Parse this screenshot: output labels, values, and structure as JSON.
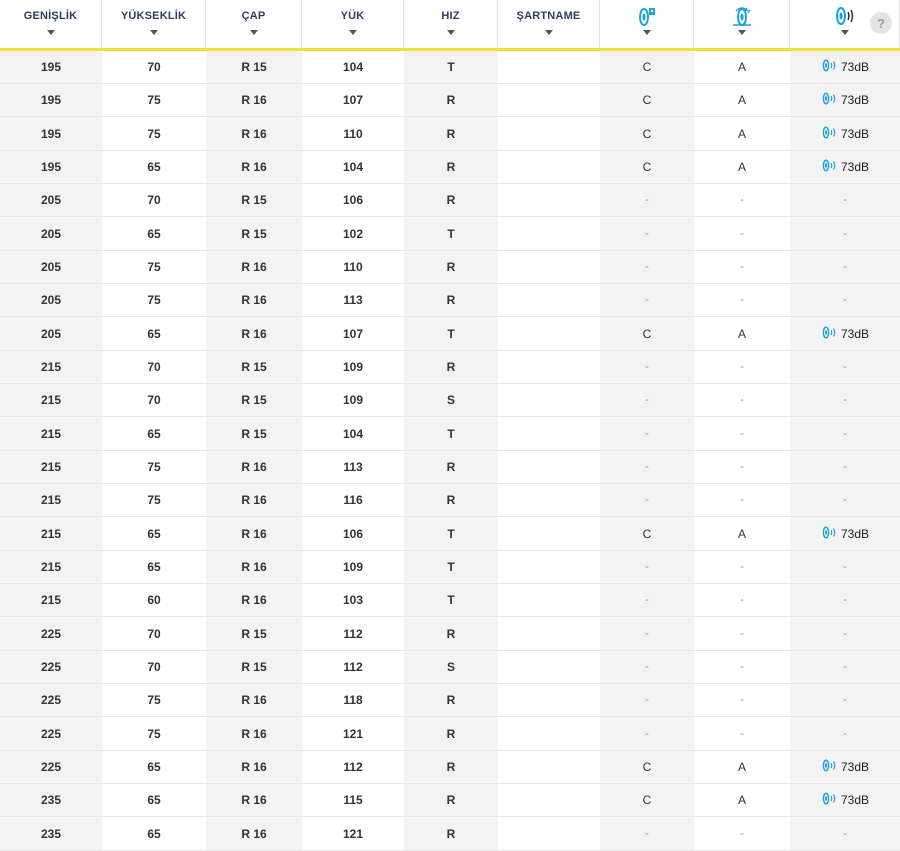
{
  "header": {
    "columns": [
      {
        "label": "GENİŞLİK"
      },
      {
        "label": "YÜKSEKLİK"
      },
      {
        "label": "ÇAP"
      },
      {
        "label": "YÜK"
      },
      {
        "label": "HIZ"
      },
      {
        "label": "ŞARTNAME"
      },
      {
        "label": "",
        "icon": "fuel-efficiency-icon"
      },
      {
        "label": "",
        "icon": "wet-grip-icon"
      },
      {
        "label": "",
        "icon": "noise-icon"
      }
    ],
    "help_label": "?"
  },
  "colors": {
    "accent": "#f2e03a",
    "header_text": "#2c3e63",
    "icon_blue": "#1aa3dc"
  },
  "rows": [
    [
      "195",
      "70",
      "R 15",
      "104",
      "T",
      "",
      "C",
      "A",
      "73dB"
    ],
    [
      "195",
      "75",
      "R 16",
      "107",
      "R",
      "",
      "C",
      "A",
      "73dB"
    ],
    [
      "195",
      "75",
      "R 16",
      "110",
      "R",
      "",
      "C",
      "A",
      "73dB"
    ],
    [
      "195",
      "65",
      "R 16",
      "104",
      "R",
      "",
      "C",
      "A",
      "73dB"
    ],
    [
      "205",
      "70",
      "R 15",
      "106",
      "R",
      "",
      "-",
      "-",
      "-"
    ],
    [
      "205",
      "65",
      "R 15",
      "102",
      "T",
      "",
      "-",
      "-",
      "-"
    ],
    [
      "205",
      "75",
      "R 16",
      "110",
      "R",
      "",
      "-",
      "-",
      "-"
    ],
    [
      "205",
      "75",
      "R 16",
      "113",
      "R",
      "",
      "-",
      "-",
      "-"
    ],
    [
      "205",
      "65",
      "R 16",
      "107",
      "T",
      "",
      "C",
      "A",
      "73dB"
    ],
    [
      "215",
      "70",
      "R 15",
      "109",
      "R",
      "",
      "-",
      "-",
      "-"
    ],
    [
      "215",
      "70",
      "R 15",
      "109",
      "S",
      "",
      "-",
      "-",
      "-"
    ],
    [
      "215",
      "65",
      "R 15",
      "104",
      "T",
      "",
      "-",
      "-",
      "-"
    ],
    [
      "215",
      "75",
      "R 16",
      "113",
      "R",
      "",
      "-",
      "-",
      "-"
    ],
    [
      "215",
      "75",
      "R 16",
      "116",
      "R",
      "",
      "-",
      "-",
      "-"
    ],
    [
      "215",
      "65",
      "R 16",
      "106",
      "T",
      "",
      "C",
      "A",
      "73dB"
    ],
    [
      "215",
      "65",
      "R 16",
      "109",
      "T",
      "",
      "-",
      "-",
      "-"
    ],
    [
      "215",
      "60",
      "R 16",
      "103",
      "T",
      "",
      "-",
      "-",
      "-"
    ],
    [
      "225",
      "70",
      "R 15",
      "112",
      "R",
      "",
      "-",
      "-",
      "-"
    ],
    [
      "225",
      "70",
      "R 15",
      "112",
      "S",
      "",
      "-",
      "-",
      "-"
    ],
    [
      "225",
      "75",
      "R 16",
      "118",
      "R",
      "",
      "-",
      "-",
      "-"
    ],
    [
      "225",
      "75",
      "R 16",
      "121",
      "R",
      "",
      "-",
      "-",
      "-"
    ],
    [
      "225",
      "65",
      "R 16",
      "112",
      "R",
      "",
      "C",
      "A",
      "73dB"
    ],
    [
      "235",
      "65",
      "R 16",
      "115",
      "R",
      "",
      "C",
      "A",
      "73dB"
    ],
    [
      "235",
      "65",
      "R 16",
      "121",
      "R",
      "",
      "-",
      "-",
      "-"
    ]
  ]
}
